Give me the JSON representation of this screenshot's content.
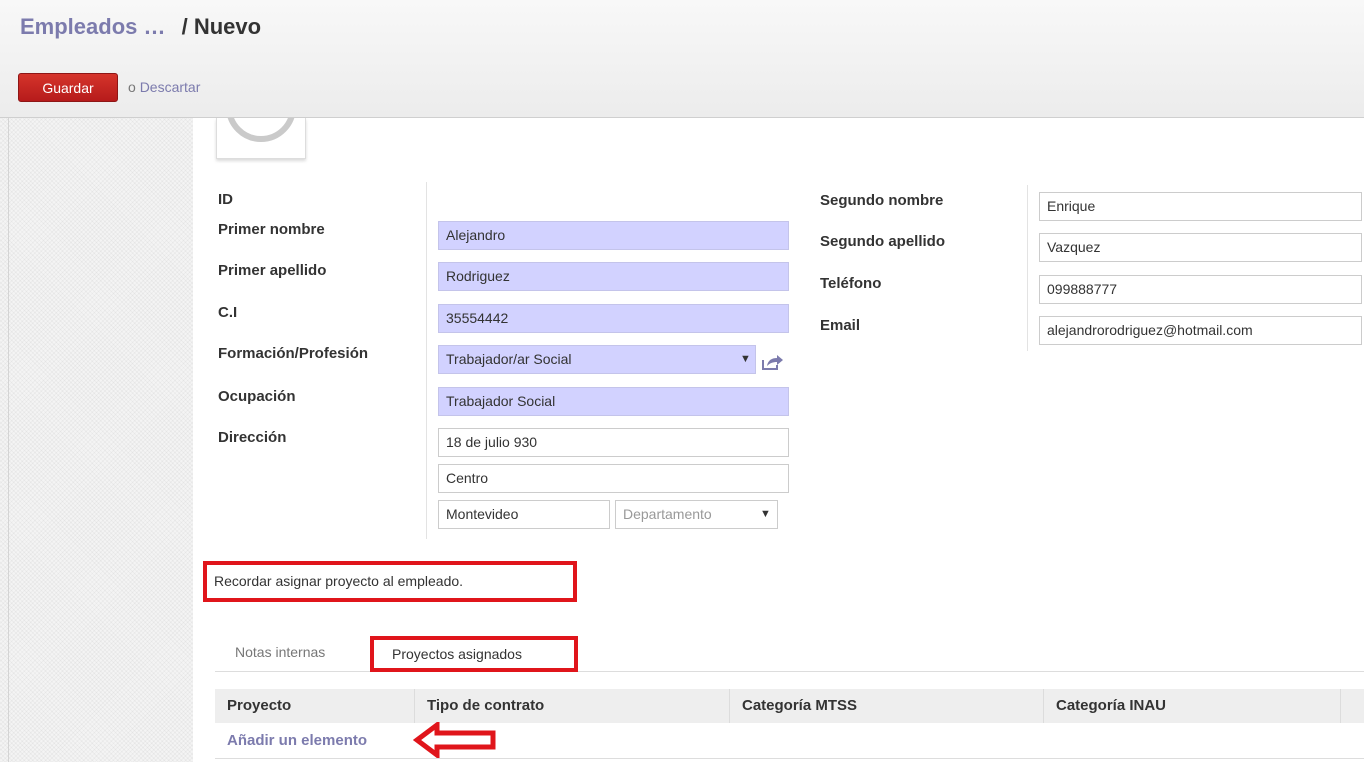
{
  "breadcrumb": {
    "parent": "Empleados …",
    "separator": "/",
    "current": "Nuevo"
  },
  "actions": {
    "save": "Guardar",
    "or": "o",
    "discard": "Descartar"
  },
  "form": {
    "left": {
      "id_label": "ID",
      "first_name_label": "Primer nombre",
      "first_name": "Alejandro",
      "last_name_label": "Primer apellido",
      "last_name": "Rodriguez",
      "ci_label": "C.I",
      "ci": "35554442",
      "profession_label": "Formación/Profesión",
      "profession": "Trabajador/ar Social",
      "occupation_label": "Ocupación",
      "occupation": "Trabajador Social",
      "address_label": "Dirección",
      "street": "18 de julio 930",
      "street2": "Centro",
      "city": "Montevideo",
      "department_placeholder": "Departamento"
    },
    "right": {
      "second_name_label": "Segundo nombre",
      "second_name": "Enrique",
      "second_last_name_label": "Segundo apellido",
      "second_last_name": "Vazquez",
      "phone_label": "Teléfono",
      "phone": "099888777",
      "email_label": "Email",
      "email": "alejandrorodriguez@hotmail.com"
    }
  },
  "note": "Recordar asignar proyecto al empleado.",
  "tabs": [
    {
      "label": "Notas internas",
      "active": false
    },
    {
      "label": "Proyectos asignados",
      "active": true
    }
  ],
  "table": {
    "columns": [
      "Proyecto",
      "Tipo de contrato",
      "Categoría MTSS",
      "Categoría INAU"
    ],
    "add_item": "Añadir un elemento"
  },
  "colors": {
    "accent": "#7c7bad",
    "save_button": "#c4211e",
    "required_field": "#d2d2ff",
    "highlight": "#e0151b"
  },
  "icons": [
    "external-link-icon",
    "dropdown-caret-icon",
    "red-arrow-icon"
  ]
}
